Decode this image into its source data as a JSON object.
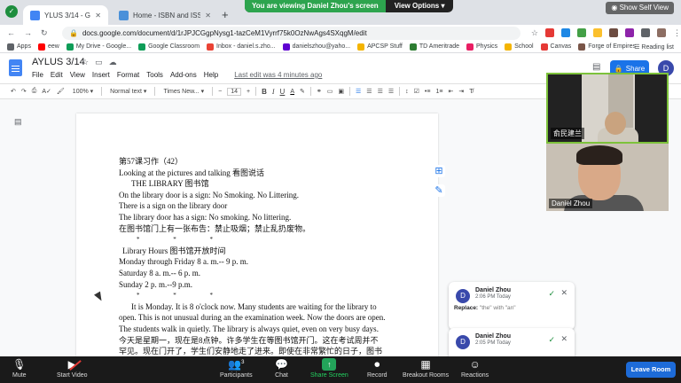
{
  "browser": {
    "tabs": [
      {
        "title": "YLUS 3/14 - Google Docs",
        "favicon_color": "#4285f4"
      },
      {
        "title": "Home - ISBN and ISSN Systems",
        "favicon_color": "#4a90d9"
      }
    ],
    "url": "docs.google.com/document/d/1rJPJCGgpNysg1-tazCeM1Vyrrf75k0OzNwAgs4SXqgM/edit",
    "bookmarks": [
      {
        "label": "Apps",
        "color": "#5f6368"
      },
      {
        "label": "eew",
        "color": "#ff0000"
      },
      {
        "label": "My Drive - Google...",
        "color": "#0f9d58"
      },
      {
        "label": "Google Classroom",
        "color": "#0f9d58"
      },
      {
        "label": "Inbox - daniel.s.zho...",
        "color": "#ea4335"
      },
      {
        "label": "danielszhou@yaho...",
        "color": "#5f01d1"
      },
      {
        "label": "APCSP Stuff",
        "color": "#f4b400"
      },
      {
        "label": "TD Ameritrade",
        "color": "#2e7d32"
      },
      {
        "label": "Physics",
        "color": "#e91e63"
      },
      {
        "label": "School",
        "color": "#f4b400"
      },
      {
        "label": "Canvas",
        "color": "#e53935"
      },
      {
        "label": "Forge of Empires",
        "color": "#795548"
      }
    ],
    "reading_list": "Reading list"
  },
  "zoom_banner": {
    "viewing": "You are viewing Daniel Zhou's screen",
    "options": "View Options",
    "self_view": "Show Self View"
  },
  "docs": {
    "title": "AYLUS 3/14",
    "menus": [
      "File",
      "Edit",
      "View",
      "Insert",
      "Format",
      "Tools",
      "Add-ons",
      "Help"
    ],
    "last_edit": "Last edit was 4 minutes ago",
    "share": "Share",
    "account_initial": "D",
    "toolbar": {
      "zoom": "100%",
      "style": "Normal text",
      "font": "Times New...",
      "size": "14"
    },
    "lines": [
      "第57课习作（42）",
      "Looking at the pictures and talking 看图说话",
      "THE LIBRARY 图书馆",
      "On the library door is a sign: No Smoking. No Littering.",
      "There is a sign on the library door",
      "The library door has a sign: No smoking. No littering.",
      "在图书馆门上有一张布告：禁止吸烟；禁止乱扔废物。",
      "*   *   *",
      "Library Hours 图书馆开放时间",
      "Monday through Friday 8 a. m.-- 9 p. m.",
      "Saturday 8 a. m.-- 6 p. m.",
      "Sunday 2 p. m.--9 p.m.",
      "*   *   *",
      "It is Monday. It is 8 o'clock now. Many students are waiting for the library to",
      "open. This is not unusual during an the examination week. Now the doors are open.",
      "The students walk in quietly. The library is always quiet,   even on very busy days.",
      "今天是星期一，现在是8点钟。许多学生在等图书馆开门。这在考试周并不",
      "罕见。现在门开了，学生们安静地走了进来。即使在非常繁忙的日子，图书"
    ],
    "comments": [
      {
        "initial": "D",
        "author": "Daniel Zhou",
        "time": "2:06 PM Today",
        "replace_label": "Replace:",
        "replace_text": "\"the\" with \"an\""
      },
      {
        "initial": "D",
        "author": "Daniel Zhou",
        "time": "2:05 PM Today"
      }
    ]
  },
  "video": {
    "tile1_name": "俞民建兰",
    "tile2_name": "Daniel Zhou"
  },
  "zoom_toolbar": {
    "mute": "Mute",
    "start_video": "Start Video",
    "participants": "Participants",
    "participants_count": "3",
    "chat": "Chat",
    "share_screen": "Share Screen",
    "record": "Record",
    "breakout": "Breakout Rooms",
    "reactions": "Reactions",
    "leave": "Leave Room"
  }
}
